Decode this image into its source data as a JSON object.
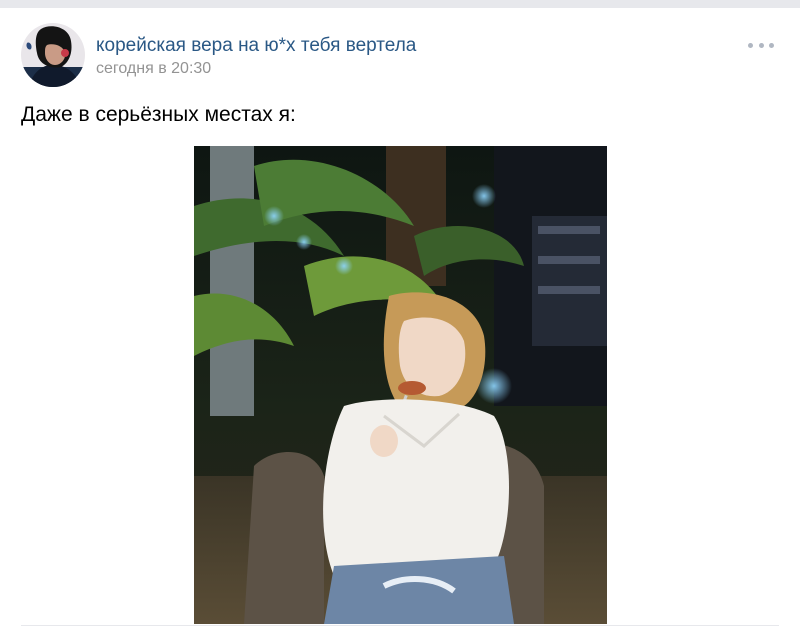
{
  "post": {
    "author": "корейская вера на ю*х тебя вертела",
    "time": "сегодня в 20:30",
    "text": "Даже в серьёзных местах я:"
  },
  "icons": {
    "more": "more-dots-icon"
  },
  "colors": {
    "author_link": "#2a5885",
    "meta_gray": "#939393",
    "divider": "#e7e8ec"
  }
}
